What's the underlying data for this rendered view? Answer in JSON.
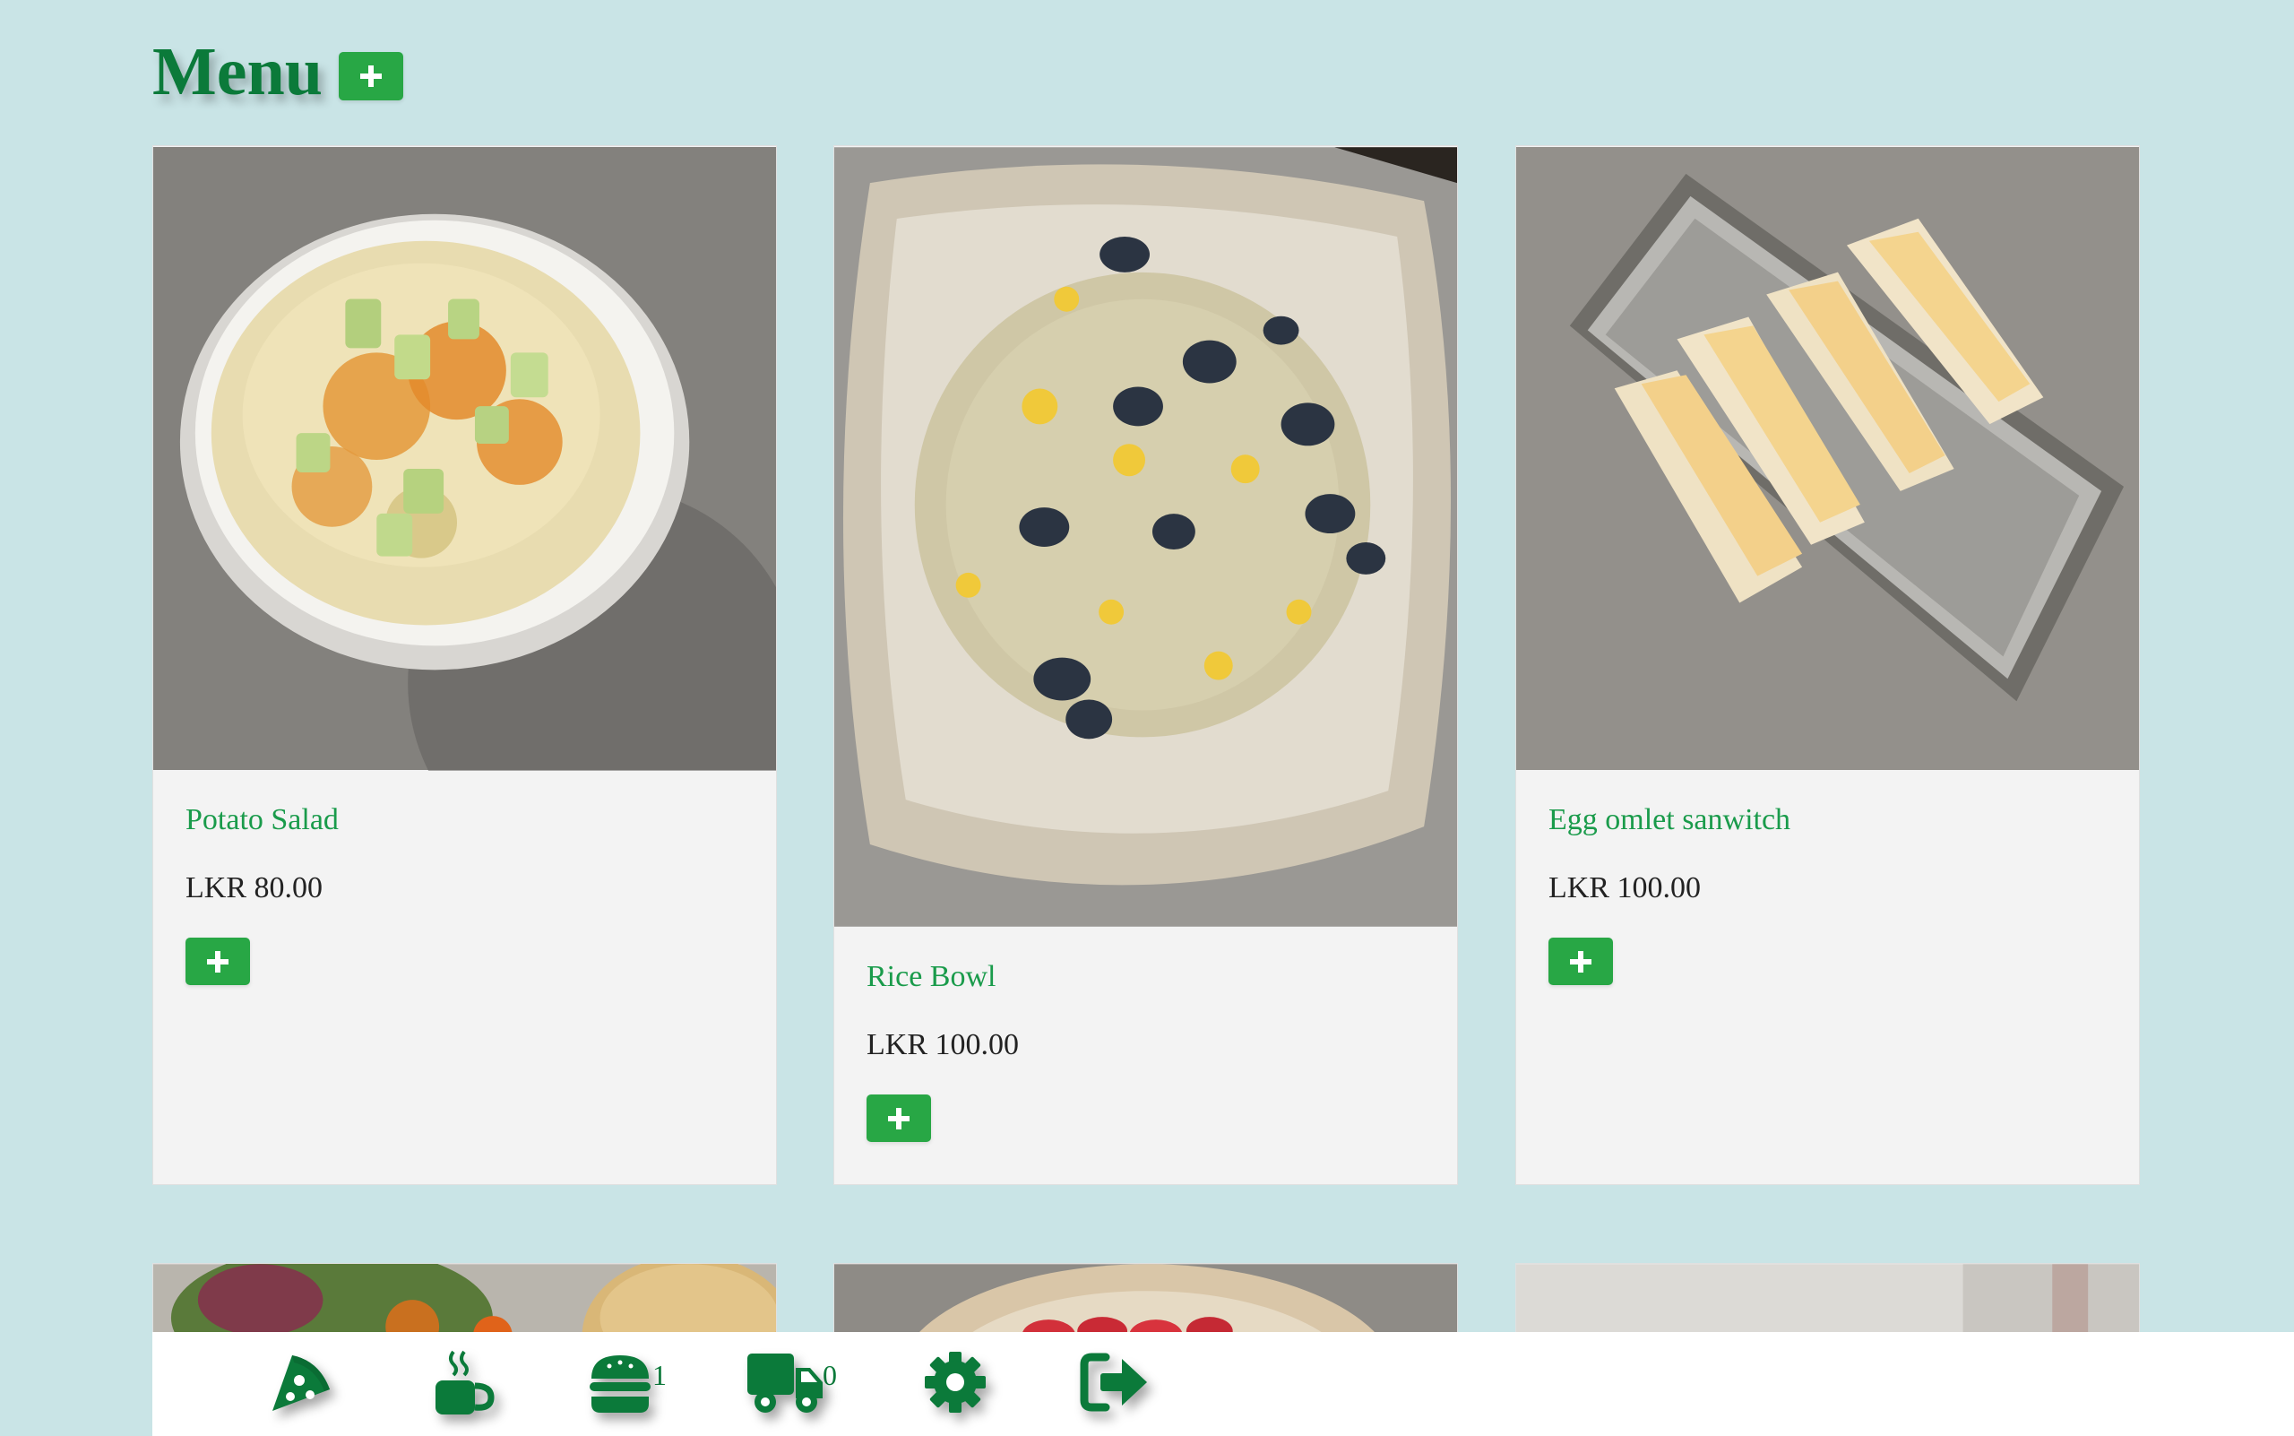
{
  "header": {
    "title": "Menu"
  },
  "menu_items": [
    {
      "name": "Potato Salad",
      "price": "LKR 80.00"
    },
    {
      "name": "Rice Bowl",
      "price": "LKR 100.00"
    },
    {
      "name": "Egg omlet sanwitch",
      "price": "LKR 100.00"
    }
  ],
  "bottom_nav": {
    "items": [
      {
        "icon": "pizza-icon"
      },
      {
        "icon": "coffee-icon"
      },
      {
        "icon": "burger-icon",
        "count": "1"
      },
      {
        "icon": "truck-icon",
        "count": "0"
      },
      {
        "icon": "gear-icon"
      },
      {
        "icon": "sign-out-icon"
      }
    ]
  },
  "colors": {
    "background": "#c9e4e6",
    "brand_green": "#0b7a3a",
    "button_green": "#28a745",
    "item_title": "#1a9b4b",
    "card_bg": "#f3f3f3"
  }
}
